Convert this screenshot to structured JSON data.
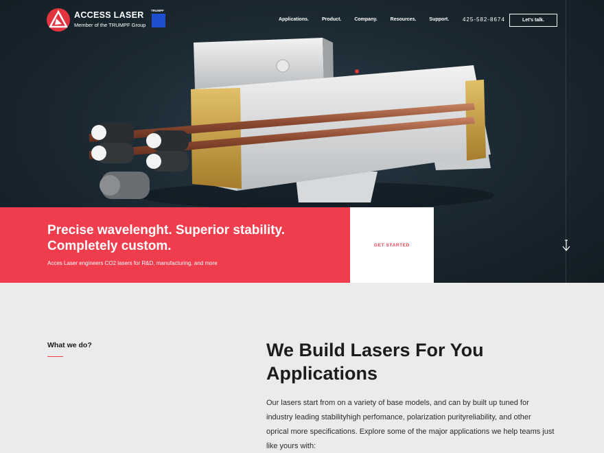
{
  "brand": {
    "name": "ACCESS LASER",
    "tagline": "Member of the TRUMPF Group",
    "partner": "TRUMPF",
    "accent_color": "#ef3d4d",
    "partner_color": "#1f4fd1"
  },
  "nav": {
    "items": [
      "Applications.",
      "Product.",
      "Company.",
      "Resources.",
      "Support."
    ],
    "phone": "425-582-8674",
    "cta": "Let's talk."
  },
  "hero": {
    "headline": "Precise wavelenght. Superior stability. Completely custom.",
    "subline": "Acces Laser engineers CO2 lasers for R&D, manufacturing, and more",
    "cta": "GET STARTED",
    "scroll_icon": "arrow-down-icon"
  },
  "about": {
    "label": "What we do?",
    "title": "We Build Lasers For You Applications",
    "body": "Our lasers start from on a variety of base models, and can by built up tuned for industry leading stabilityhigh perfomance, polarization purityreliability, and other oprical more specifications. Explore some of the major applications we help teams just like yours with:"
  }
}
